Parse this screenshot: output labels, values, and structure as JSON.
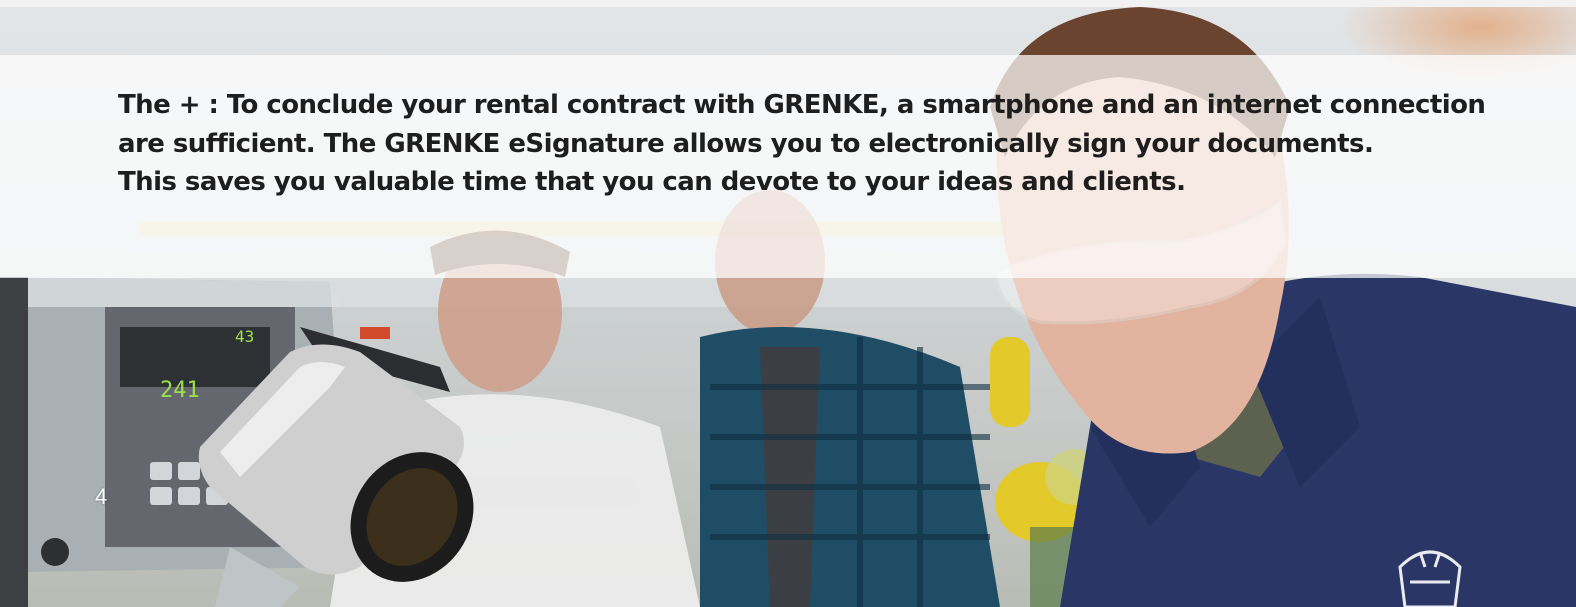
{
  "document": {
    "paragraph_lines": [
      "The + : To conclude your rental contract with GRENKE, a smartphone and an internet connection",
      "are sufficient. The GRENKE eSignature allows you to electronically sign your documents.",
      "This saves you valuable time that you can devote to your ideas and clients."
    ],
    "page_number": "4"
  },
  "photo": {
    "subject": "workshop-scene-with-technician-in-safety-glasses",
    "colors": {
      "uniform": "#2a3766",
      "shirt_plaid": "#1f4d66",
      "machine": "#9aa3a6",
      "lamp": "#c9c9c9",
      "accent_orange": "#e07a2f",
      "accent_yellow": "#e4c92a"
    }
  }
}
